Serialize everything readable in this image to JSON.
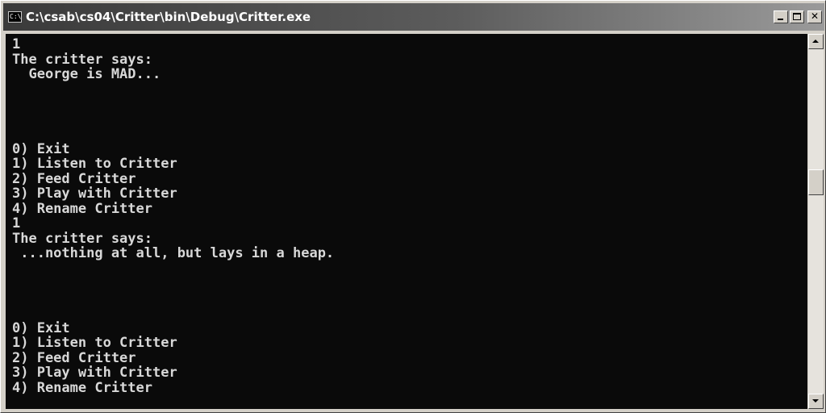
{
  "window": {
    "title": "C:\\csab\\cs04\\Critter\\bin\\Debug\\Critter.exe",
    "icon_text": "C:\\"
  },
  "icons": {
    "app": "console-app-icon",
    "minimize": "minimize-icon",
    "maximize": "maximize-icon",
    "close": "close-icon",
    "scroll_up": "scroll-up-arrow-icon",
    "scroll_down": "scroll-down-arrow-icon"
  },
  "colors": {
    "titlebar_start": "#3a3a3a",
    "console_background": "#0a0a0a",
    "console_text": "#d8d8d8"
  },
  "console": {
    "output": "1\nThe critter says:\n  George is MAD...\n\n\n\n\n0) Exit\n1) Listen to Critter\n2) Feed Critter\n3) Play with Critter\n4) Rename Critter\n1\nThe critter says:\n ...nothing at all, but lays in a heap.\n\n\n\n\n0) Exit\n1) Listen to Critter\n2) Feed Critter\n3) Play with Critter\n4) Rename Critter"
  }
}
